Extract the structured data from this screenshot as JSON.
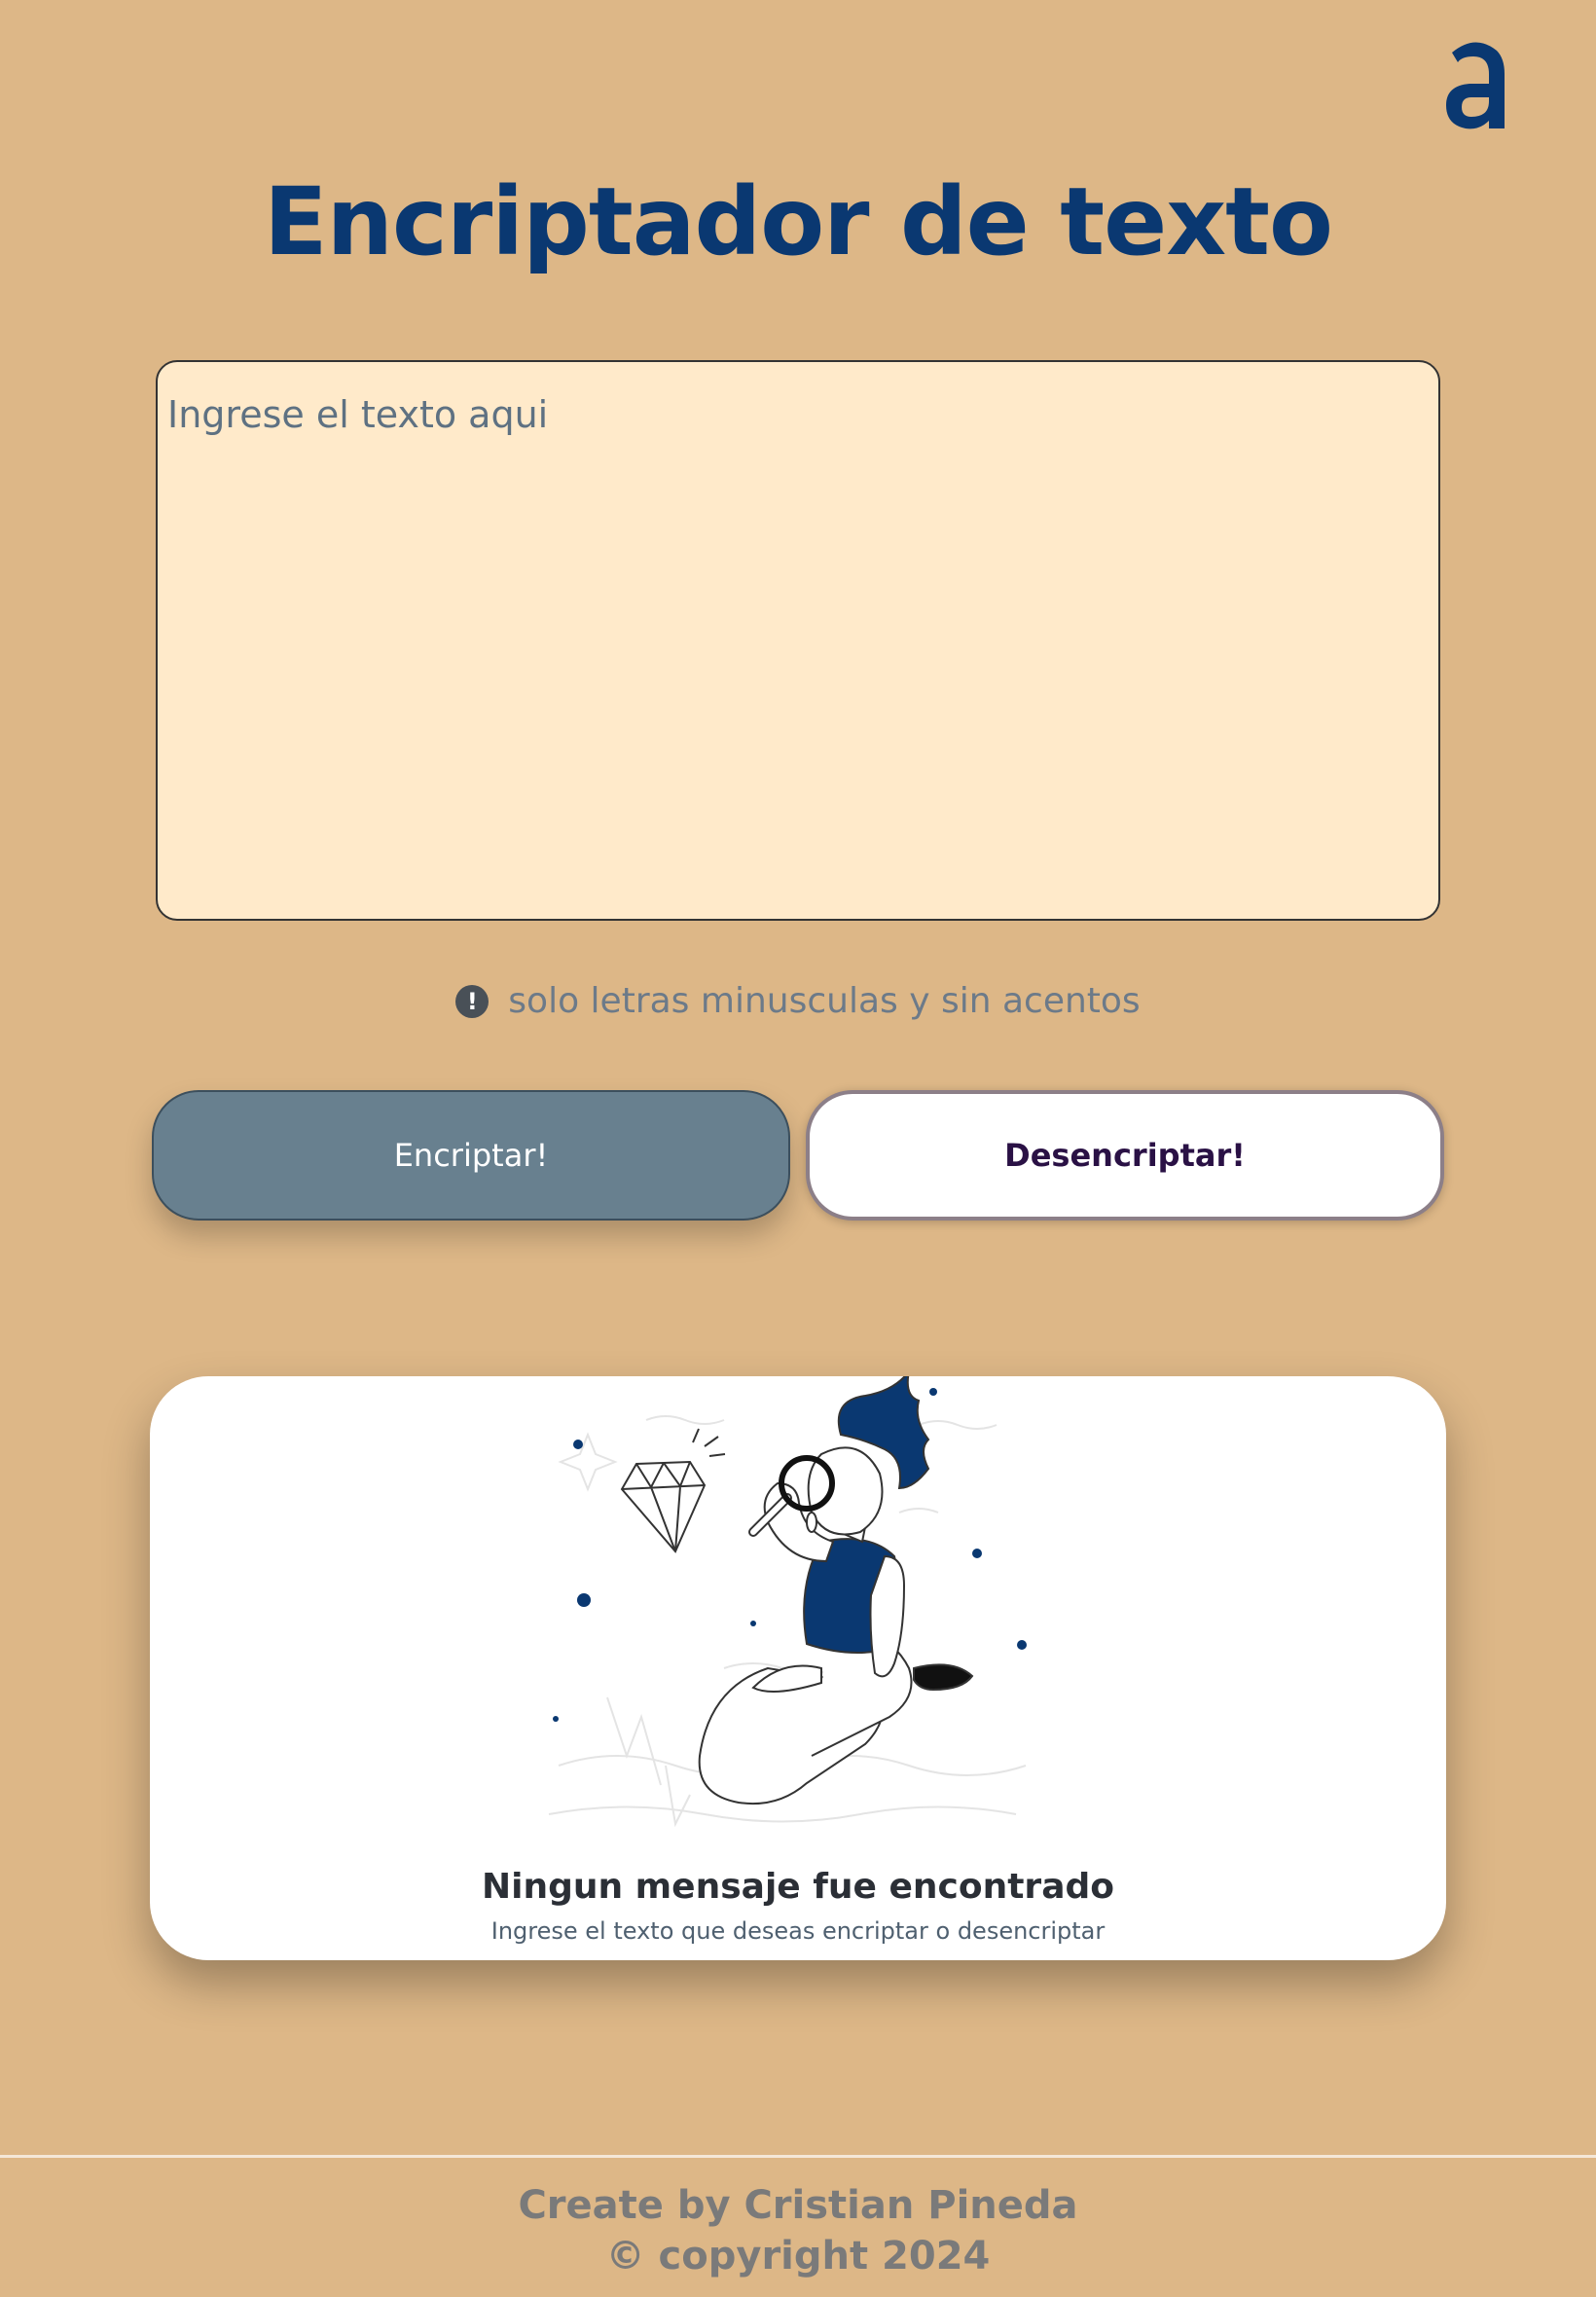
{
  "brand": {
    "logo_icon": "alura-a-icon",
    "color": "#0A3871"
  },
  "header": {
    "title": "Encriptador de texto"
  },
  "input": {
    "placeholder": "Ingrese el texto aqui",
    "value": ""
  },
  "hint": {
    "icon": "exclamation-circle-icon",
    "text": "solo letras minusculas y sin acentos"
  },
  "buttons": {
    "encrypt_label": "Encriptar!",
    "decrypt_label": "Desencriptar!"
  },
  "result": {
    "illustration": "person-with-magnifier-illustration",
    "title": "Ningun mensaje fue encontrado",
    "subtitle": "Ingrese el texto que deseas encriptar o desencriptar"
  },
  "footer": {
    "line1": "Create by Cristian Pineda",
    "line2": "© copyright 2024"
  },
  "colors": {
    "background": "#DDB787",
    "textarea_bg": "#FFEACA",
    "primary": "#0A3871",
    "encrypt_bg": "#68808F",
    "decrypt_bg": "#FFFFFF"
  }
}
